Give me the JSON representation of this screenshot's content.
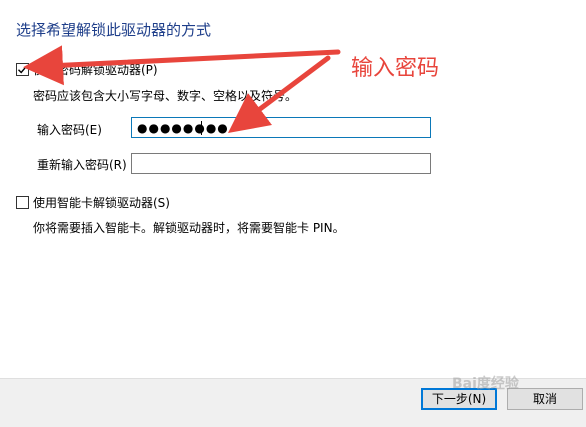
{
  "dialog": {
    "heading": "选择希望解锁此驱动器的方式"
  },
  "password_option": {
    "label": "使用密码解锁驱动器(P)",
    "checked": true,
    "hint": "密码应该包含大小写字母、数字、空格以及符号。",
    "enter_label": "输入密码(E)",
    "enter_value": "●●●●●●●●",
    "reenter_label": "重新输入密码(R)",
    "reenter_value": ""
  },
  "smartcard_option": {
    "label": "使用智能卡解锁驱动器(S)",
    "checked": false,
    "hint": "你将需要插入智能卡。解锁驱动器时，将需要智能卡 PIN。"
  },
  "annotation": {
    "text": "输入密码",
    "color": "#e8453c"
  },
  "footer": {
    "next_label": "下一步(N)",
    "cancel_label": "取消"
  },
  "watermark": {
    "text": "Bai度经验"
  },
  "colors": {
    "heading": "#1e3e8a",
    "focus_border": "#0b78b8",
    "primary_button_border": "#0078d7"
  }
}
